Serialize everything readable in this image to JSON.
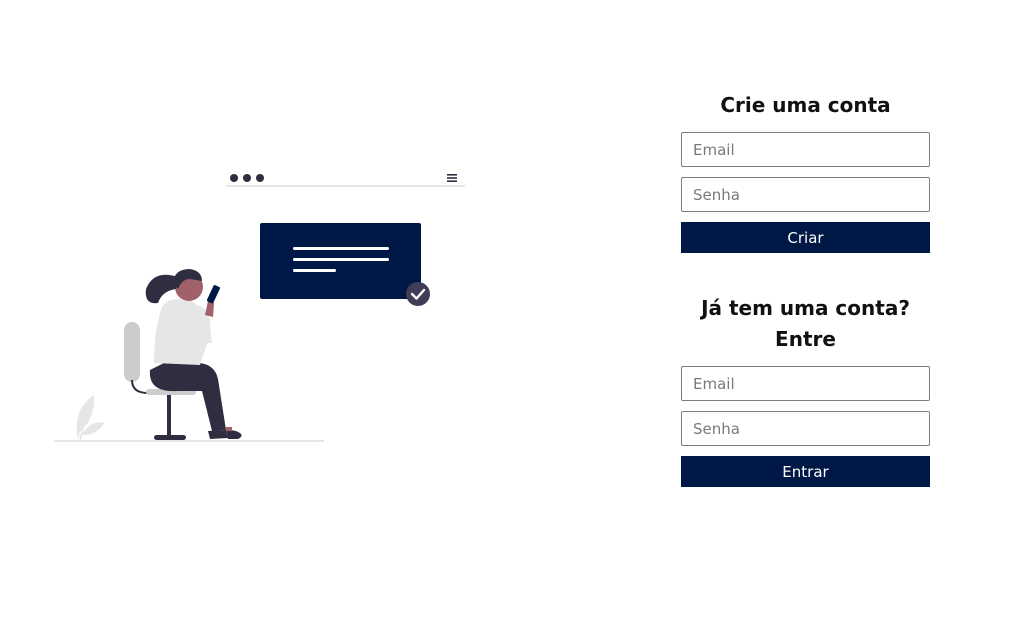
{
  "signup": {
    "title": "Crie uma conta",
    "email_placeholder": "Email",
    "password_placeholder": "Senha",
    "button_label": "Criar"
  },
  "login": {
    "title": "Já tem uma conta? Entre",
    "email_placeholder": "Email",
    "password_placeholder": "Senha",
    "button_label": "Entrar"
  },
  "colors": {
    "accent": "#001845",
    "dark_figure": "#2f2e41",
    "skin": "#a0616a",
    "light_gray": "#e6e6e6"
  },
  "illustration": {
    "icons": [
      "browser-dots-icon",
      "hamburger-menu-icon",
      "message-card",
      "check-circle-icon",
      "woman-on-chair",
      "plant-leaf-icon"
    ]
  }
}
